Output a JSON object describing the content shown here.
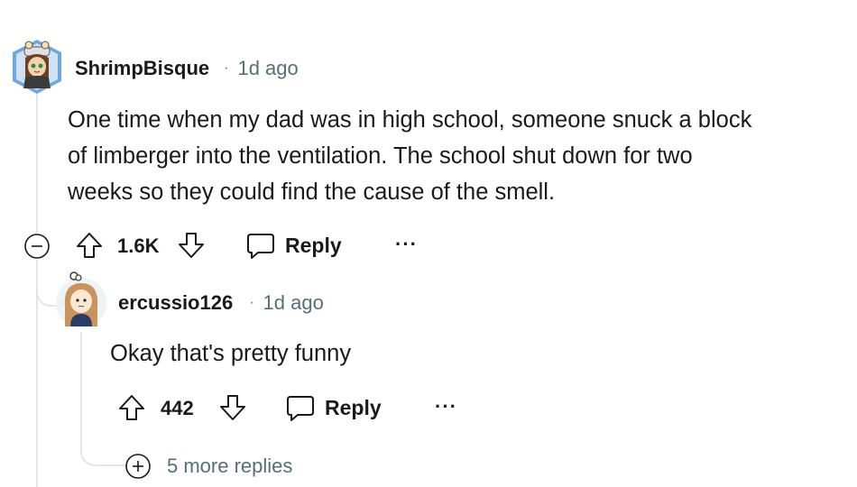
{
  "comment": {
    "author": "ShrimpBisque",
    "separator": "·",
    "age": "1d ago",
    "body_lines": [
      "One time when my dad was in high school, someone snuck a block",
      "of limberger into the ventilation. The school shut down for two",
      "weeks so they could find the cause of the smell."
    ],
    "score": "1.6K",
    "reply_label": "Reply",
    "more_label": "···"
  },
  "reply": {
    "author": "ercussio126",
    "separator": "·",
    "age": "1d ago",
    "body": "Okay that's pretty funny",
    "score": "442",
    "reply_label": "Reply",
    "more_label": "···"
  },
  "more_replies_label": "5 more replies",
  "icons": [
    "collapse-icon",
    "upvote-icon",
    "downvote-icon",
    "reply-icon",
    "more-icon",
    "expand-icon"
  ],
  "colors": {
    "text": "#1a1a1b",
    "meta": "#576f76",
    "thread_line": "#e3e5e7"
  }
}
